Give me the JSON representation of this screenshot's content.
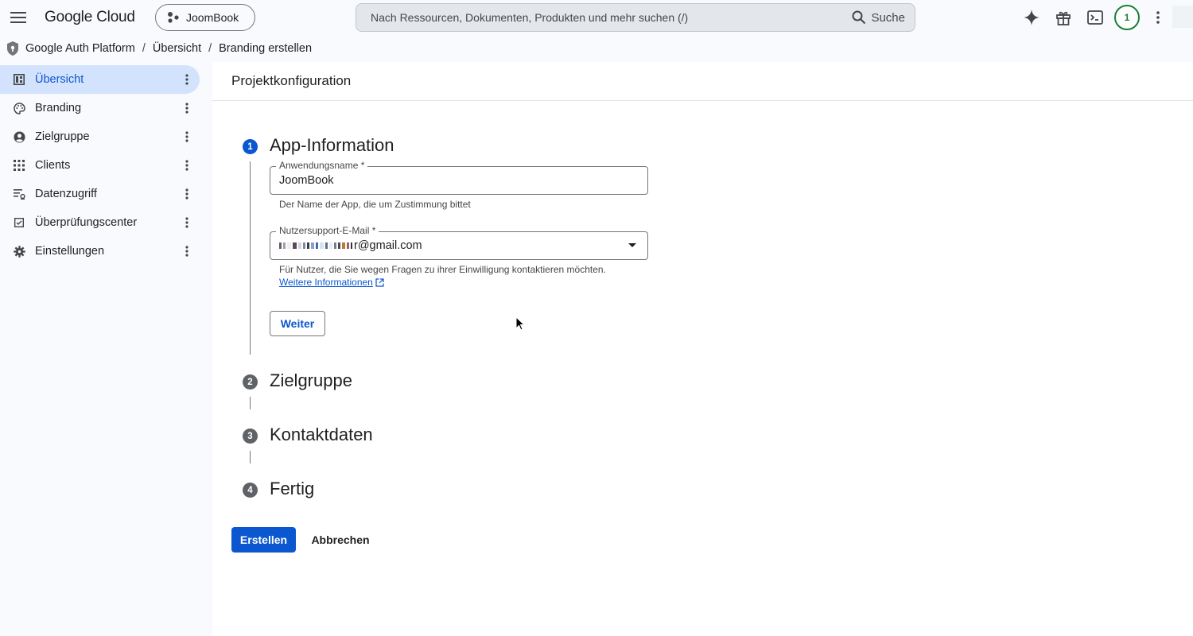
{
  "header": {
    "brand": "Google Cloud",
    "project": "JoomBook",
    "search_placeholder": "Nach Ressourcen, Dokumenten, Produkten und mehr suchen (/)",
    "search_button": "Suche",
    "notification_count": "1"
  },
  "breadcrumb": {
    "items": [
      "Google Auth Platform",
      "Übersicht",
      "Branding erstellen"
    ],
    "separator": "/"
  },
  "sidebar": {
    "items": [
      {
        "label": "Übersicht",
        "icon": "dashboard-icon",
        "active": true
      },
      {
        "label": "Branding",
        "icon": "palette-icon"
      },
      {
        "label": "Zielgruppe",
        "icon": "account-circle-icon"
      },
      {
        "label": "Clients",
        "icon": "apps-grid-icon"
      },
      {
        "label": "Datenzugriff",
        "icon": "data-access-icon"
      },
      {
        "label": "Überprüfungscenter",
        "icon": "verification-icon"
      },
      {
        "label": "Einstellungen",
        "icon": "gear-icon"
      }
    ]
  },
  "main": {
    "title": "Projektkonfiguration",
    "steps": [
      {
        "number": "1",
        "title": "App-Information",
        "state": "active"
      },
      {
        "number": "2",
        "title": "Zielgruppe",
        "state": "inactive"
      },
      {
        "number": "3",
        "title": "Kontaktdaten",
        "state": "inactive"
      },
      {
        "number": "4",
        "title": "Fertig",
        "state": "inactive"
      }
    ],
    "app_name_field": {
      "label": "Anwendungsname *",
      "value": "JoomBook",
      "helper": "Der Name der App, die um Zustimmung bittet"
    },
    "support_email_field": {
      "label": "Nutzersupport-E-Mail *",
      "value_visible": "r@gmail.com",
      "helper": "Für Nutzer, die Sie wegen Fragen zu ihrer Einwilligung kontaktieren möchten.",
      "link": "Weitere Informationen"
    },
    "next_button": "Weiter",
    "create_button": "Erstellen",
    "cancel_button": "Abbrechen"
  },
  "colors": {
    "accent": "#0b57d0",
    "active_nav_bg": "#d3e3fd",
    "sidebar_bg": "#f8fafd",
    "avatar_ring": "#188038"
  }
}
